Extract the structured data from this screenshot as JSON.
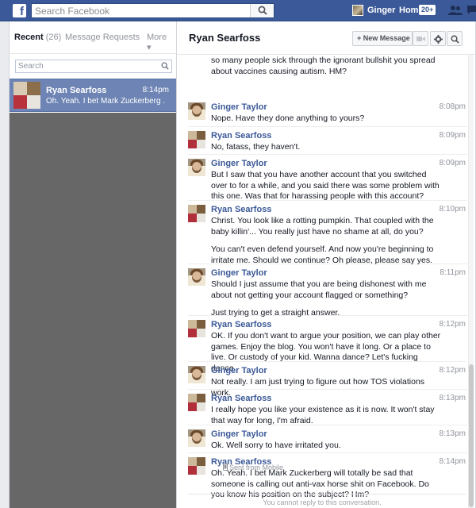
{
  "topbar": {
    "logo_letter": "f",
    "search_placeholder": "Search Facebook",
    "user_name": "Ginger",
    "home_label": "Home",
    "home_badge": "20+"
  },
  "sidebar": {
    "tab_recent": "Recent",
    "tab_recent_count": "(26)",
    "tab_requests": "Message Requests",
    "tab_more": "More ▾",
    "search_placeholder": "Search",
    "threads": [
      {
        "name": "Ryan Searfoss",
        "time": "8:14pm",
        "snippet": "Oh. Yeah. I bet Mark Zuckerberg ..."
      }
    ]
  },
  "conversation": {
    "title": "Ryan Searfoss",
    "new_message_label": "+ New Message",
    "partial_top": "so many people sick through the ignorant bullshit you spread about vaccines causing autism. HM?",
    "messages": [
      {
        "sender": "Ginger Taylor",
        "time": "8:08pm",
        "paragraphs": [
          "Nope.  Have they done anything to yours?"
        ]
      },
      {
        "sender": "Ryan Searfoss",
        "time": "8:09pm",
        "paragraphs": [
          "No, fatass, they haven't."
        ]
      },
      {
        "sender": "Ginger Taylor",
        "time": "8:09pm",
        "paragraphs": [
          "But I saw that you have another account that you switched over to for a while, and you said there was some problem with this one.  Was that for harassing people with this account?"
        ]
      },
      {
        "sender": "Ryan Searfoss",
        "time": "8:10pm",
        "paragraphs": [
          "Christ. You look like a rotting pumpkin. That coupled with the baby killin'... You really just have no shame at all, do you?",
          "You can't even defend yourself. And now you're beginning to irritate me. Should we continue? Oh please, please say yes."
        ]
      },
      {
        "sender": "Ginger Taylor",
        "time": "8:11pm",
        "paragraphs": [
          "Should I just assume that you are being dishonest with me about not getting your account flagged or something?",
          "Just trying to get a straight answer."
        ]
      },
      {
        "sender": "Ryan Searfoss",
        "time": "8:12pm",
        "paragraphs": [
          "OK. If you don't want to argue your position, we can play other games. Enjoy the blog. You won't have it long. Or a place to live. Or custody of your kid. Wanna dance? Let's fucking dance."
        ]
      },
      {
        "sender": "Ginger Taylor",
        "time": "8:12pm",
        "paragraphs": [
          "Not really.  I am just trying to figure out how TOS violations work."
        ]
      },
      {
        "sender": "Ryan Searfoss",
        "time": "8:13pm",
        "paragraphs": [
          "I really hope you like your existence as it is now. It won't stay that way for long, I'm afraid."
        ]
      },
      {
        "sender": "Ginger Taylor",
        "time": "8:13pm",
        "paragraphs": [
          "Ok.  Well sorry to have irritated you."
        ]
      },
      {
        "sender": "Ryan Searfoss",
        "time": "8:14pm",
        "paragraphs": [
          "Oh. Yeah. I bet Mark Zuckerberg will totally be sad that someone is calling out anti-vax horse shit on Facebook. Do you know his position on the subject? Hm?"
        ]
      }
    ],
    "sent_from": "Sent from Mobile",
    "cannot_reply": "You cannot reply to this conversation."
  }
}
